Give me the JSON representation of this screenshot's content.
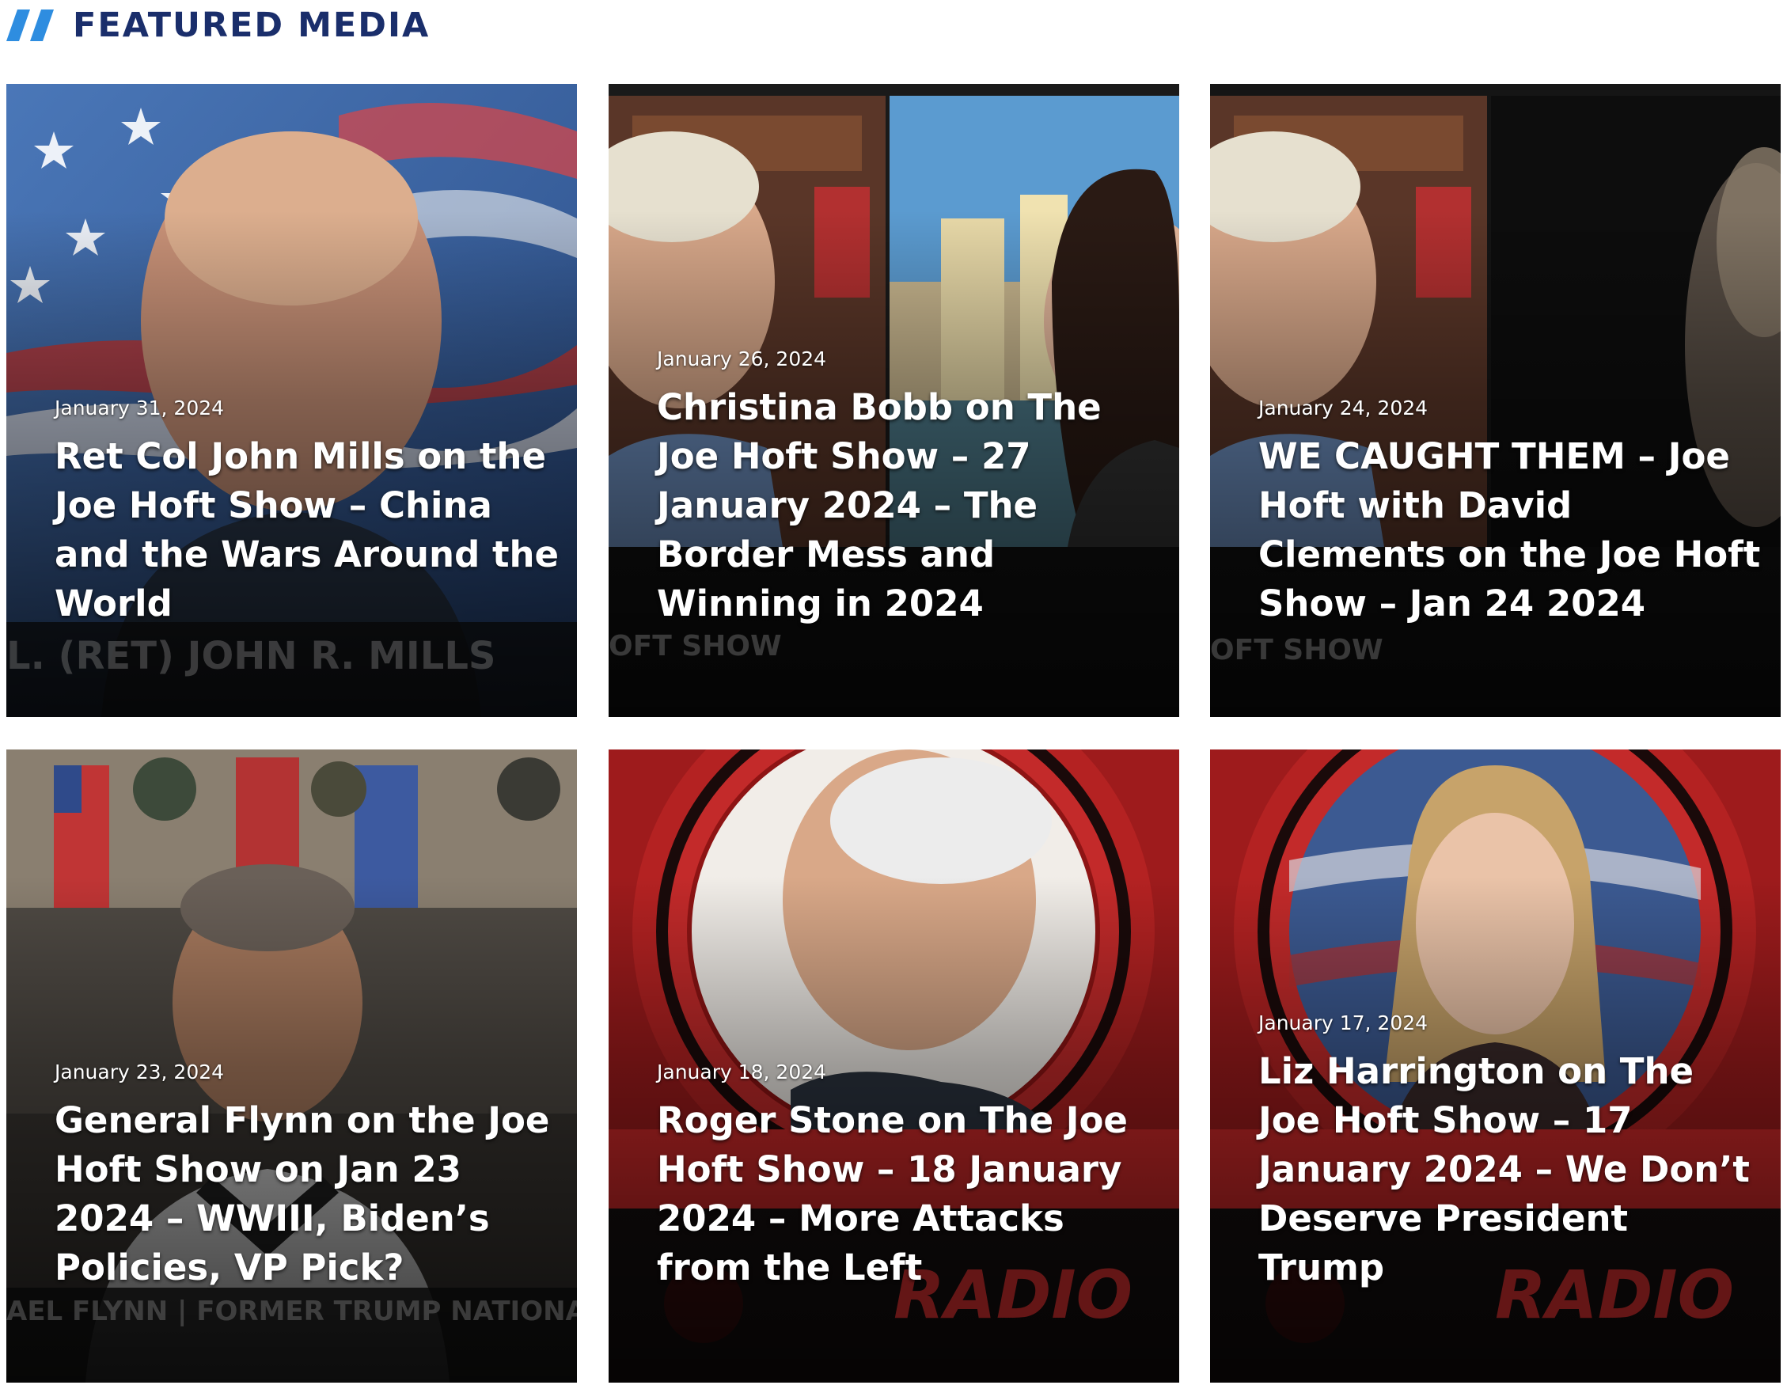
{
  "section": {
    "title": "FEATURED MEDIA",
    "icon": "double-slash-icon",
    "accent_color": "#2e8de0",
    "title_color": "#1a2e6b"
  },
  "cards": [
    {
      "date": "January 31, 2024",
      "title": "Ret Col John Mills on the Joe Hoft Show – China and the Wars Around the World",
      "thumb_text": "L. (RET) JOHN R. MILLS"
    },
    {
      "date": "January 26, 2024",
      "title": "Christina Bobb on The Joe Hoft Show – 27 January 2024 – The Border Mess and Winning in 2024",
      "thumb_text": "OFT SHOW"
    },
    {
      "date": "January 24, 2024",
      "title": "WE CAUGHT THEM – Joe Hoft with David Clements on the Joe Hoft Show – Jan 24 2024",
      "thumb_text": "OFT SHOW"
    },
    {
      "date": "January 23, 2024",
      "title": "General Flynn on the Joe Hoft Show on Jan 23 2024 – WWIII, Biden’s Policies, VP Pick?",
      "thumb_text": "AEL FLYNN | FORMER TRUMP NATIONAL SEC"
    },
    {
      "date": "January 18, 2024",
      "title": "Roger Stone on The Joe Hoft Show – 18 January 2024 – More Attacks from the Left",
      "thumb_text": "RADIO"
    },
    {
      "date": "January 17, 2024",
      "title": "Liz Harrington on The Joe Hoft Show – 17 January 2024 – We Don’t Deserve President Trump",
      "thumb_text": "RADIO"
    }
  ]
}
